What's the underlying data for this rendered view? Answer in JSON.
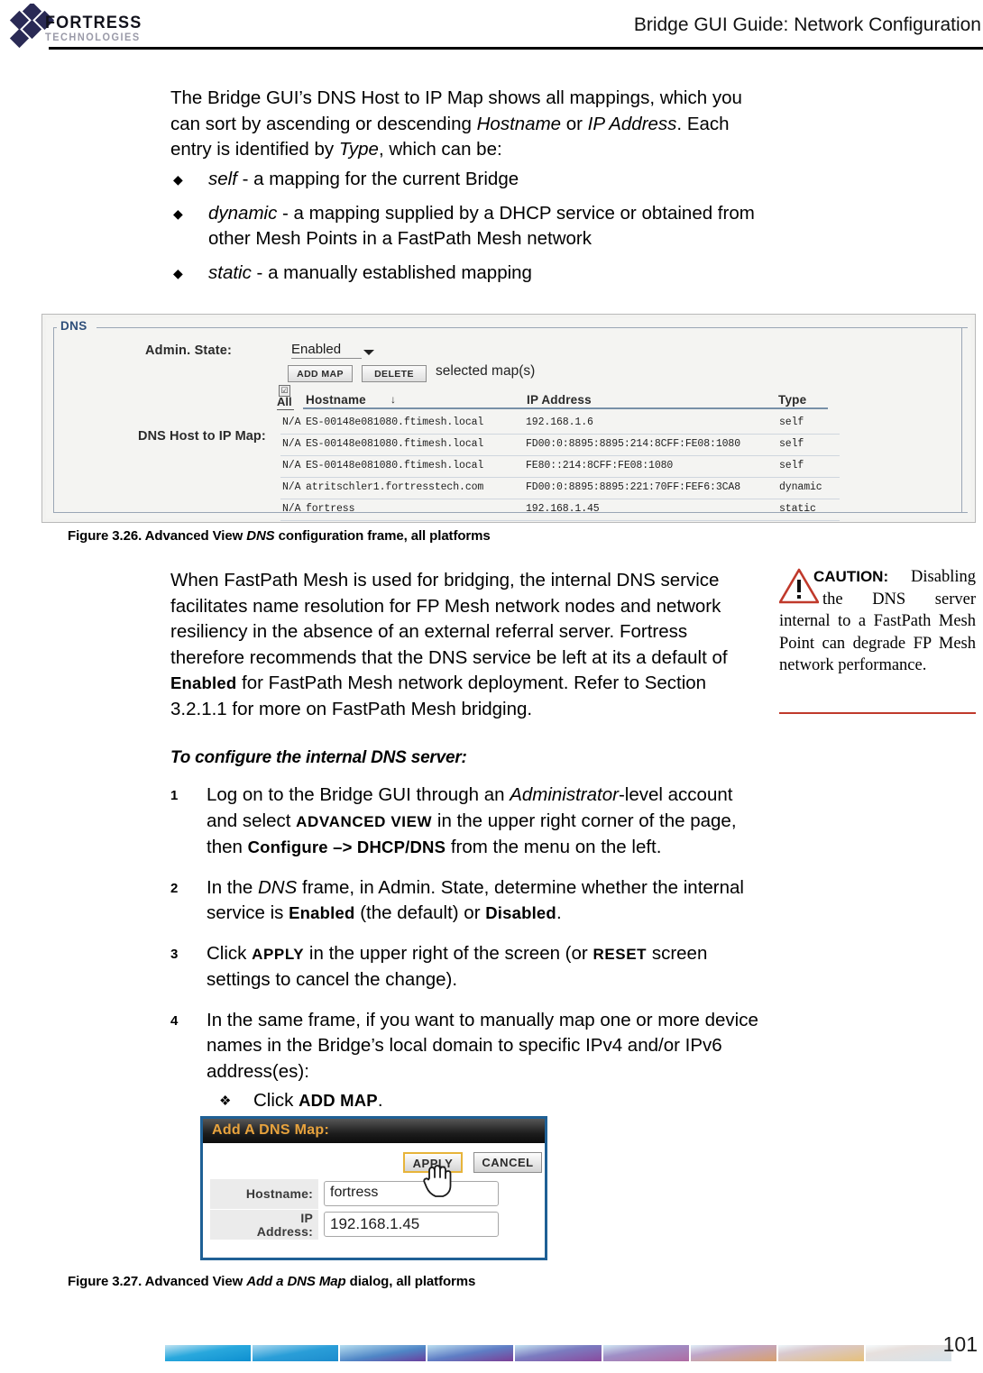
{
  "header": {
    "logo_primary": "FORTRESS",
    "logo_secondary": "TECHNOLOGIES",
    "title": "Bridge GUI Guide: Network Configuration"
  },
  "intro": {
    "paragraph_html": "The Bridge GUI’s DNS Host to IP Map shows all mappings, which you can sort by ascending or descending <i class=\"it\">Hostname</i> or <i class=\"it\">IP Address</i>. Each entry is identified by <i class=\"it\">Type</i>, which can be:",
    "bullets": [
      {
        "mark": "◆",
        "html": "<i class=\"it\">self</i> - a mapping for the current Bridge"
      },
      {
        "mark": "◆",
        "html": "<i class=\"it\">dynamic</i> - a mapping supplied by a DHCP service or obtained from other Mesh Points in a FastPath Mesh network"
      },
      {
        "mark": "◆",
        "html": "<i class=\"it\">static</i> - a manually established mapping"
      }
    ]
  },
  "figure_dns": {
    "legend": "DNS",
    "admin_state_label": "Admin. State:",
    "admin_state_value": "Enabled",
    "add_map_button": "ADD MAP",
    "delete_button": "DELETE",
    "selected_maps_text": "selected map(s)",
    "all_checkbox_label": "All",
    "all_checkbox_mark": "☑",
    "map_label": "DNS Host to IP Map:",
    "columns": [
      "Hostname",
      "IP Address",
      "Type"
    ],
    "sort_indicator": "↓",
    "rows": [
      {
        "select": "N/A",
        "hostname": "ES-00148e081080.ftimesh.local",
        "ip": "192.168.1.6",
        "type": "self"
      },
      {
        "select": "N/A",
        "hostname": "ES-00148e081080.ftimesh.local",
        "ip": "FD00:0:8895:8895:214:8CFF:FE08:1080",
        "type": "self"
      },
      {
        "select": "N/A",
        "hostname": "ES-00148e081080.ftimesh.local",
        "ip": "FE80::214:8CFF:FE08:1080",
        "type": "self"
      },
      {
        "select": "N/A",
        "hostname": "atritschler1.fortresstech.com",
        "ip": "FD00:0:8895:8895:221:70FF:FEF6:3CA8",
        "type": "dynamic"
      },
      {
        "select": "N/A",
        "hostname": "fortress",
        "ip": "192.168.1.45",
        "type": "static"
      }
    ],
    "caption_html": "Figure 3.26. Advanced View <i class=\"it\">DNS</i> configuration frame, all platforms"
  },
  "caution": {
    "label": "CAUTION:",
    "icon": "warning-triangle-icon",
    "text": " Disabling the DNS server internal to a FastPath Mesh Point can degrade FP Mesh network performance.",
    "accent_color": "#c0392b"
  },
  "mesh_paragraph": {
    "html": "When FastPath Mesh is used for bridging, the internal DNS service facilitates name resolution for FP Mesh network nodes and network resiliency in the absence of an external referral server. Fortress therefore recommends that the DNS service be left at its a default of <b class=\"bd\">Enabled</b> for FastPath Mesh network deployment. Refer to Section 3.2.1.1 for more on FastPath Mesh bridging."
  },
  "procedure": {
    "title": "To configure the internal DNS server:",
    "steps": [
      {
        "num": "1",
        "html": "Log on to the Bridge GUI through an <i class=\"it\">Administrator</i>-level account and select <b class=\"sc\">ADVANCED VIEW</b> in the upper right corner of the page, then <b class=\"bd\">Configure –&gt; DHCP/DNS</b> from the menu on the left."
      },
      {
        "num": "2",
        "html": "In the <i class=\"it\">DNS</i> frame, in Admin. State, determine whether the internal service is <b class=\"bd\">Enabled</b> (the default) or <b class=\"bd\">Disabled</b>."
      },
      {
        "num": "3",
        "html": "Click <b class=\"sc\">APPLY</b> in the upper right of the screen (or <b class=\"sc\">RESET</b> screen settings to cancel the change)."
      },
      {
        "num": "4",
        "html": "In the same frame, if you want to manually map one or more device names in the Bridge’s local domain to specific IPv4 and/or IPv6 address(es):"
      }
    ],
    "substep": {
      "mark": "❖",
      "html": "Click <b class=\"bd\">ADD MAP</b>."
    }
  },
  "figure_dialog": {
    "title": "Add A DNS Map:",
    "apply_button": "APPLY",
    "cancel_button": "CANCEL",
    "hostname_label": "Hostname:",
    "hostname_value": "fortress",
    "ip_label_line1": "IP",
    "ip_label_line2": "Address:",
    "ip_value": "192.168.1.45",
    "caption_html": "Figure 3.27. Advanced View <i class=\"it\">Add a DNS Map</i> dialog, all platforms"
  },
  "footer": {
    "page_number": "101",
    "bar_segments": [
      "linear-gradient(170deg,#bfe3f2 0%,#29a8dd 45%,#0d8fd0 100%)",
      "linear-gradient(170deg,#a9d8ef 0%,#2a9ed8 50%,#1c8ccd 100%)",
      "linear-gradient(170deg,#b6def0 0%,#4f86c6 55%,#6a3f9e 100%)",
      "linear-gradient(170deg,#bcdff0 0%,#5f7ec5 50%,#7b3f96 100%)",
      "linear-gradient(170deg,#c6e4f2 0%,#7b7cc0 45%,#8a4a9e 100%)",
      "linear-gradient(170deg,#d2e9f4 0%,#9f8fc6 40%,#b06ba2 100%)",
      "linear-gradient(170deg,#e0eff7 0%,#c0a6c8 35%,#d9a06e 100%)",
      "linear-gradient(170deg,#edf6fa 0%,#d9c9cf 30%,#e6c07a 100%)",
      "linear-gradient(170deg,#f6fbfd 0%,#e7e0dd 30%,#d7e3ea 100%)"
    ]
  }
}
